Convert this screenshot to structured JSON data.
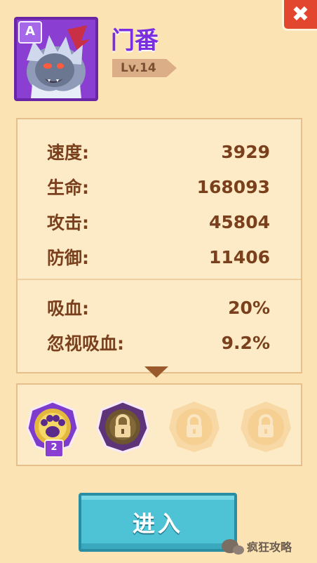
{
  "close_button": {
    "label": "✖"
  },
  "hero": {
    "rank": "A",
    "name": "门番",
    "level": "Lv.14"
  },
  "stats": [
    {
      "label": "速度:",
      "value": "3929"
    },
    {
      "label": "生命:",
      "value": "168093"
    },
    {
      "label": "攻击:",
      "value": "45804"
    },
    {
      "label": "防御:",
      "value": "11406"
    }
  ],
  "special_stats": [
    {
      "label": "吸血:",
      "value": "20%"
    },
    {
      "label": "忽视吸血:",
      "value": "9.2%"
    }
  ],
  "skills": [
    {
      "icon": "paw-skill-icon",
      "level": "2",
      "state": "unlocked"
    },
    {
      "icon": "lock-icon",
      "state": "locked-dark"
    },
    {
      "icon": "lock-icon",
      "state": "locked-faded"
    },
    {
      "icon": "lock-icon",
      "state": "locked-faded"
    }
  ],
  "enter_button": {
    "label": "进入"
  },
  "watermark": {
    "text": "疯狂攻略"
  },
  "colors": {
    "background": "#fbe3b3",
    "accent_purple": "#8b3fd2",
    "stat_text": "#7a3f1c",
    "enter_button": "#4fc3d6",
    "close_button": "#e2462f"
  }
}
